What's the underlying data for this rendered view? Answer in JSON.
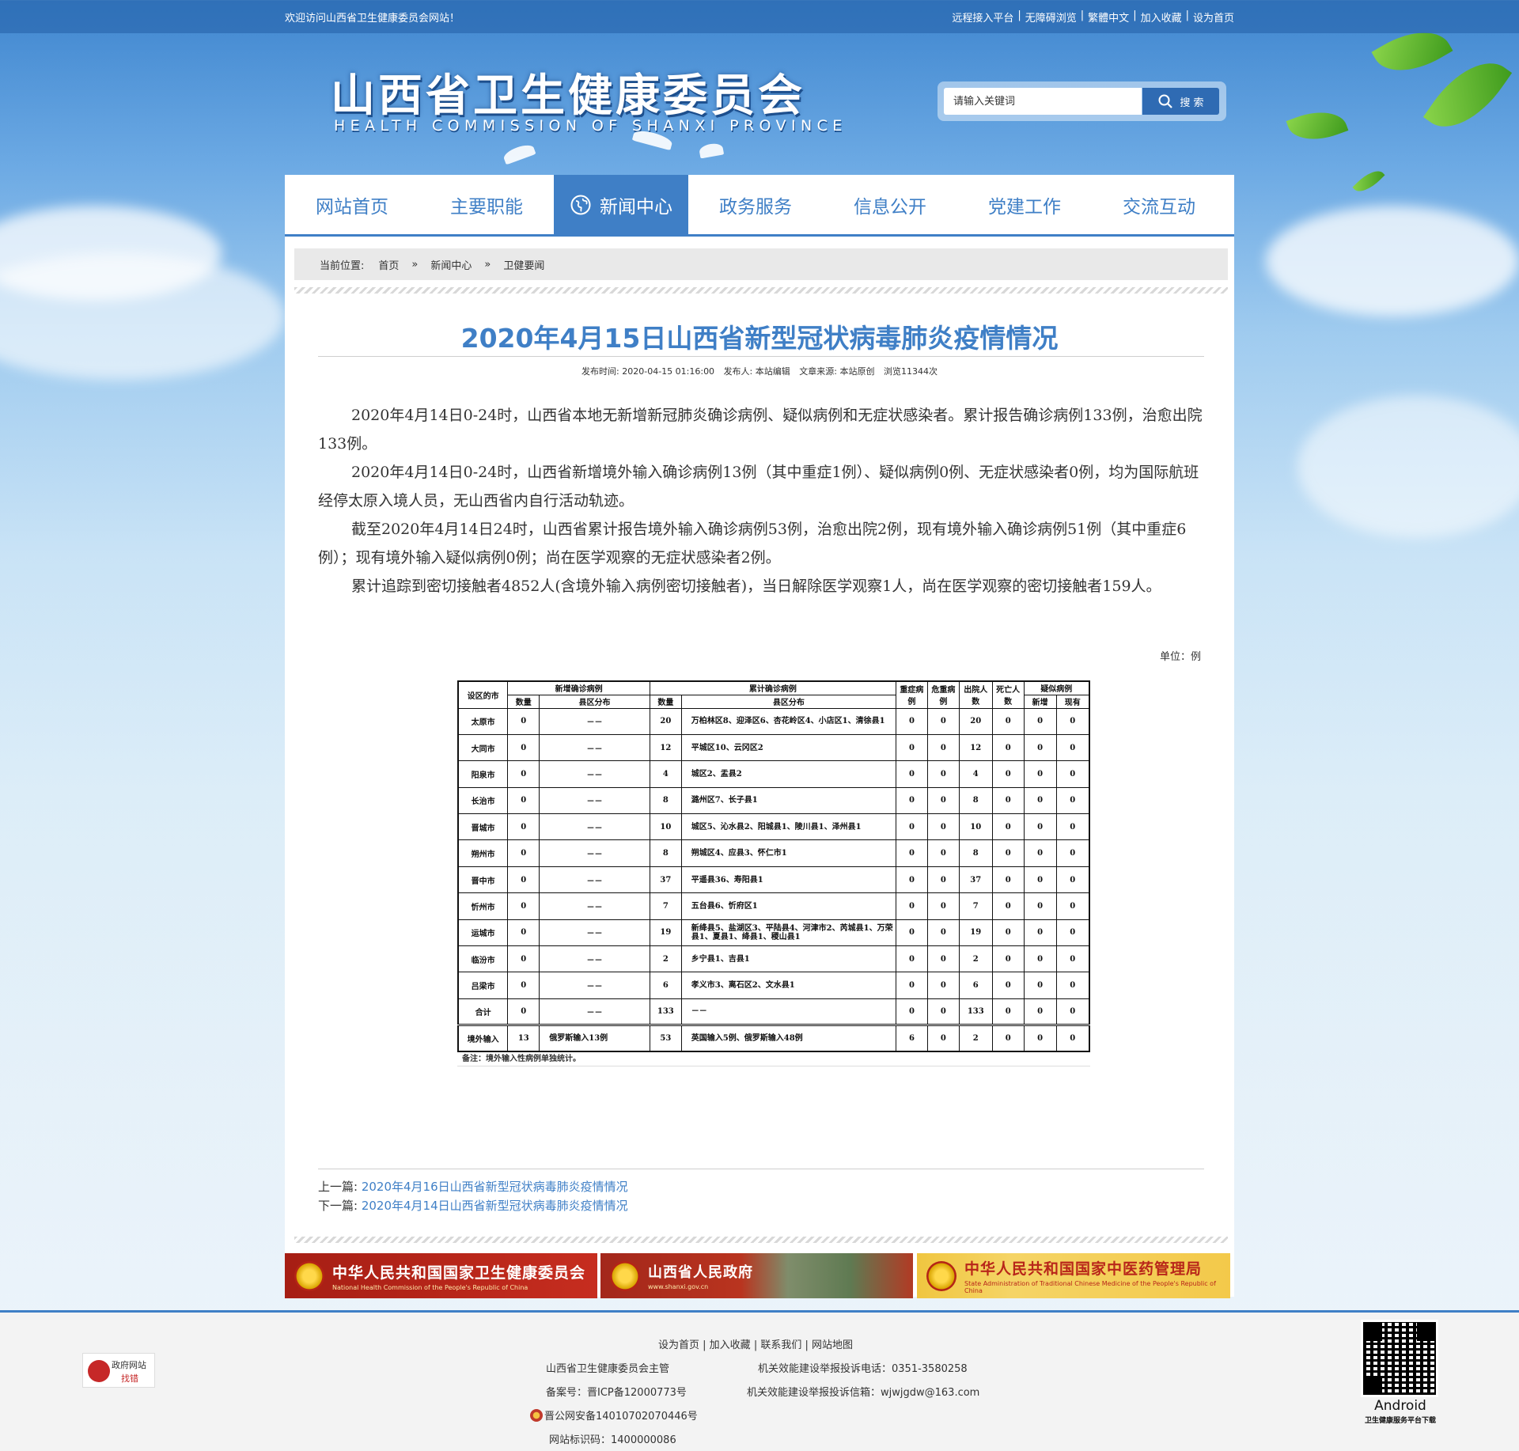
{
  "topbar": {
    "welcome": "欢迎访问山西省卫生健康委员会网站！",
    "links": [
      "远程接入平台",
      "无障碍浏览",
      "繁體中文",
      "加入收藏",
      "设为首页"
    ]
  },
  "header": {
    "logo_cn": "山西省卫生健康委员会",
    "logo_en": "HEALTH COMMISSION OF SHANXI PROVINCE",
    "search_placeholder": "请输入关键词",
    "search_button": "搜 索"
  },
  "nav": {
    "items": [
      "网站首页",
      "主要职能",
      "新闻中心",
      "政务服务",
      "信息公开",
      "党建工作",
      "交流互动"
    ],
    "active_index": 2
  },
  "breadcrumb": {
    "label": "当前位置:",
    "items": [
      "首页",
      "新闻中心",
      "卫健要闻"
    ],
    "separator": "»"
  },
  "article": {
    "title": "2020年4月15日山西省新型冠状病毒肺炎疫情情况",
    "meta": {
      "publish_time": "发布时间: 2020-04-15 01:16:00",
      "publisher": "发布人: 本站编辑",
      "source": "文章来源: 本站原创",
      "views": "浏览11344次"
    },
    "paragraphs": [
      "2020年4月14日0-24时，山西省本地无新增新冠肺炎确诊病例、疑似病例和无症状感染者。累计报告确诊病例133例，治愈出院133例。",
      "2020年4月14日0-24时，山西省新增境外输入确诊病例13例（其中重症1例）、疑似病例0例、无症状感染者0例，均为国际航班经停太原入境人员，无山西省内自行活动轨迹。",
      "截至2020年4月14日24时，山西省累计报告境外输入确诊病例53例，治愈出院2例，现有境外输入确诊病例51例（其中重症6例）；现有境外输入疑似病例0例；尚在医学观察的无症状感染者2例。",
      "累计追踪到密切接触者4852人(含境外输入病例密切接触者)，当日解除医学观察1人，尚在医学观察的密切接触者159人。"
    ],
    "unit": "单位：例"
  },
  "table": {
    "header": {
      "city": "设区的市",
      "new_group": "新增确诊病例",
      "cum_group": "累计确诊病例",
      "severe": "重症病例",
      "critical": "危重病例",
      "discharged": "出院人数",
      "deaths": "死亡人数",
      "suspected_group": "疑似病例",
      "count": "数量",
      "district": "县区分布",
      "new": "新增",
      "existing": "现有"
    },
    "rows": [
      [
        "太原市",
        "0",
        "－－",
        "20",
        "万柏林区8、迎泽区6、杏花岭区4、小店区1、清徐县1",
        "0",
        "0",
        "20",
        "0",
        "0",
        "0"
      ],
      [
        "大同市",
        "0",
        "－－",
        "12",
        "平城区10、云冈区2",
        "0",
        "0",
        "12",
        "0",
        "0",
        "0"
      ],
      [
        "阳泉市",
        "0",
        "－－",
        "4",
        "城区2、盂县2",
        "0",
        "0",
        "4",
        "0",
        "0",
        "0"
      ],
      [
        "长治市",
        "0",
        "－－",
        "8",
        "潞州区7、长子县1",
        "0",
        "0",
        "8",
        "0",
        "0",
        "0"
      ],
      [
        "晋城市",
        "0",
        "－－",
        "10",
        "城区5、沁水县2、阳城县1、陵川县1、泽州县1",
        "0",
        "0",
        "10",
        "0",
        "0",
        "0"
      ],
      [
        "朔州市",
        "0",
        "－－",
        "8",
        "朔城区4、应县3、怀仁市1",
        "0",
        "0",
        "8",
        "0",
        "0",
        "0"
      ],
      [
        "晋中市",
        "0",
        "－－",
        "37",
        "平遥县36、寿阳县1",
        "0",
        "0",
        "37",
        "0",
        "0",
        "0"
      ],
      [
        "忻州市",
        "0",
        "－－",
        "7",
        "五台县6、忻府区1",
        "0",
        "0",
        "7",
        "0",
        "0",
        "0"
      ],
      [
        "运城市",
        "0",
        "－－",
        "19",
        "新绛县5、盐湖区3、平陆县4、河津市2、芮城县1、万荣县1、夏县1、绛县1、稷山县1",
        "0",
        "0",
        "19",
        "0",
        "0",
        "0"
      ],
      [
        "临汾市",
        "0",
        "－－",
        "2",
        "乡宁县1、吉县1",
        "0",
        "0",
        "2",
        "0",
        "0",
        "0"
      ],
      [
        "吕梁市",
        "0",
        "－－",
        "6",
        "孝义市3、离石区2、文水县1",
        "0",
        "0",
        "6",
        "0",
        "0",
        "0"
      ],
      [
        "合计",
        "0",
        "－－",
        "133",
        "－－",
        "0",
        "0",
        "133",
        "0",
        "0",
        "0"
      ]
    ],
    "abroad_row": [
      "境外输入",
      "13",
      "俄罗斯输入13例",
      "53",
      "英国输入5例、俄罗斯输入48例",
      "6",
      "0",
      "2",
      "0",
      "0",
      "0"
    ],
    "note": "备注：境外输入性病例单独统计。"
  },
  "prevnext": {
    "prev_label": "上一篇:",
    "prev_title": "2020年4月16日山西省新型冠状病毒肺炎疫情情况",
    "next_label": "下一篇:",
    "next_title": "2020年4月14日山西省新型冠状病毒肺炎疫情情况"
  },
  "banners": [
    {
      "title": "中华人民共和国国家卫生健康委员会",
      "sub": "National Health Commission of the People's Republic of China"
    },
    {
      "title": "山西省人民政府",
      "sub": "www.shanxi.gov.cn"
    },
    {
      "title": "中华人民共和国国家中医药管理局",
      "sub": "State Administration of Traditional Chinese Medicine of the People's Republic of China"
    }
  ],
  "footer": {
    "links": [
      "设为首页",
      "加入收藏",
      "联系我们",
      "网站地图"
    ],
    "sponsor": "山西省卫生健康委员会主管",
    "icp": "备案号：晋ICP备12000773号",
    "police": "晋公网安备14010702070446号",
    "site_id": "网站标识码：1400000086",
    "phone": "机关效能建设举报投诉电话：0351-3580258",
    "email": "机关效能建设举报投诉信箱：wjwjgdw@163.com",
    "badge_line1": "政府网站",
    "badge_line2": "找错",
    "qr_label": "Android",
    "qr_sub": "卫生健康服务平台下载"
  },
  "colors": {
    "accent": "#3f7fc6",
    "banner_red": "#b8261a"
  }
}
